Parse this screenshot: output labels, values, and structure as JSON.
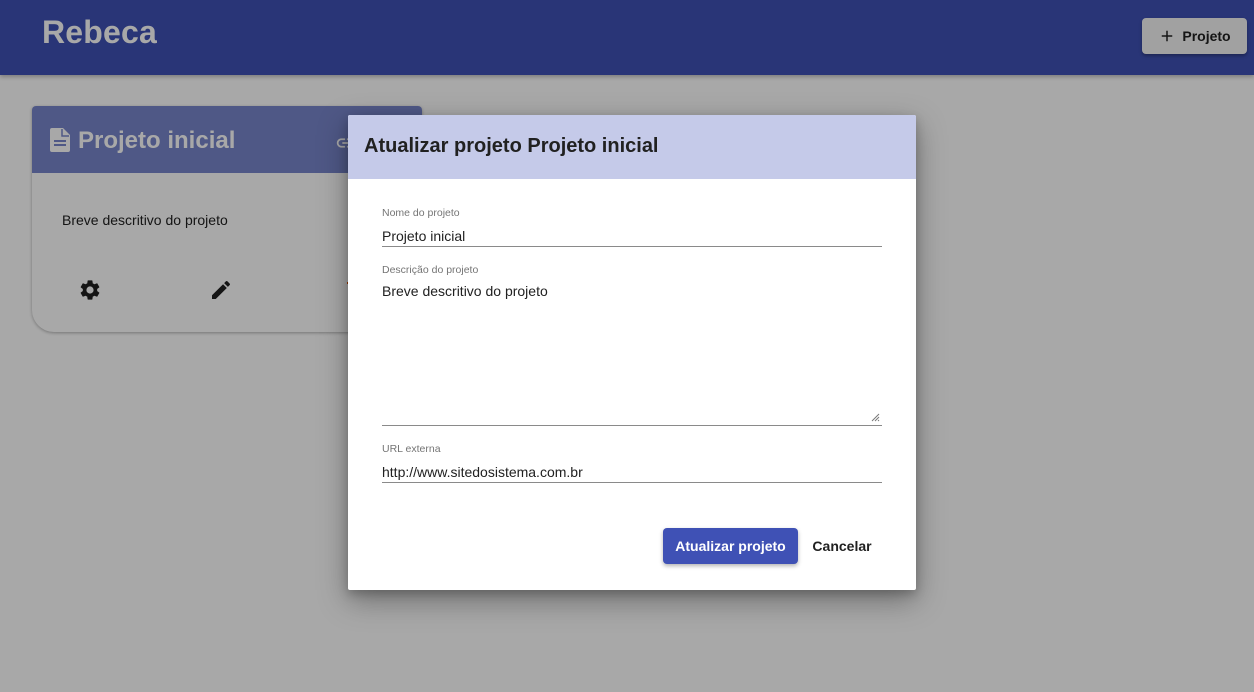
{
  "app": {
    "title": "Rebeca",
    "new_project_label": "Projeto",
    "brand_color": "#3f51b5"
  },
  "project_card": {
    "title": "Projeto inicial",
    "description": "Breve descritivo do projeto",
    "header_icon": "document-icon",
    "header_action_icon": "link-icon",
    "actions": [
      "gear-icon",
      "pencil-icon",
      "delete-icon"
    ]
  },
  "dialog": {
    "title": "Atualizar projeto Projeto inicial",
    "header_color": "#c5cae9",
    "fields": {
      "name": {
        "label": "Nome do projeto",
        "value": "Projeto inicial"
      },
      "description": {
        "label": "Descrição do projeto",
        "value": "Breve descritivo do projeto"
      },
      "url": {
        "label": "URL externa",
        "value": "http://www.sitedosistema.com.br"
      }
    },
    "submit_label": "Atualizar projeto",
    "cancel_label": "Cancelar"
  }
}
